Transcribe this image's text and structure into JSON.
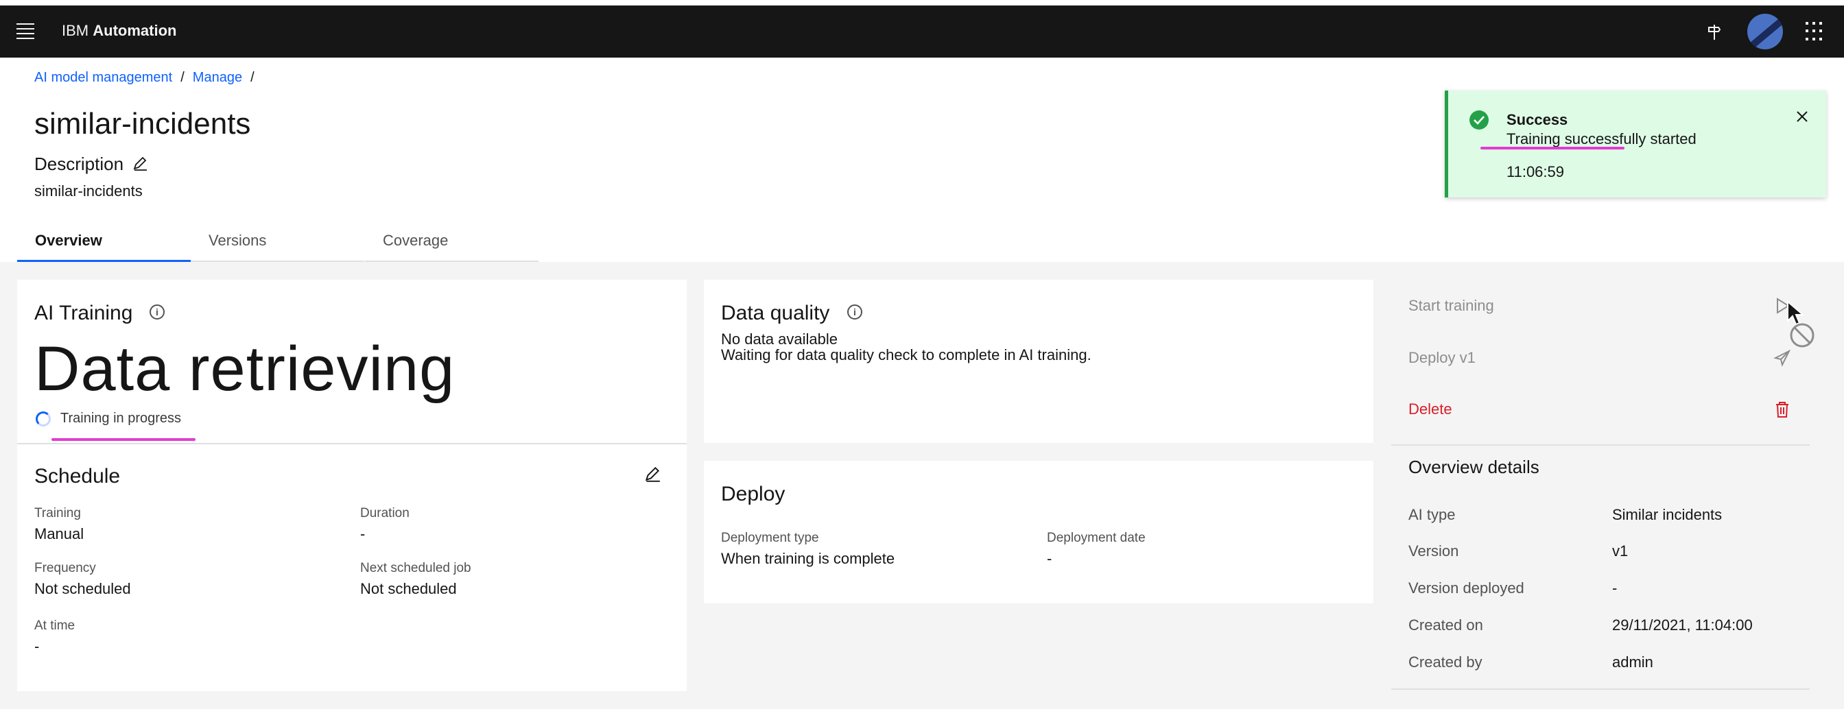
{
  "header": {
    "brand_prefix": "IBM",
    "brand_name": "Automation"
  },
  "breadcrumb": {
    "items": [
      "AI model management",
      "Manage"
    ],
    "separator": "/"
  },
  "page": {
    "title": "similar-incidents",
    "description_label": "Description",
    "description_value": "similar-incidents"
  },
  "tabs": [
    {
      "label": "Overview",
      "active": true
    },
    {
      "label": "Versions",
      "active": false
    },
    {
      "label": "Coverage",
      "active": false
    }
  ],
  "ai_training": {
    "title": "AI Training",
    "status": "Data retrieving",
    "progress_label": "Training in progress"
  },
  "schedule": {
    "title": "Schedule",
    "fields": [
      {
        "label": "Training",
        "value": "Manual"
      },
      {
        "label": "Duration",
        "value": "-"
      },
      {
        "label": "Frequency",
        "value": "Not scheduled"
      },
      {
        "label": "Next scheduled job",
        "value": "Not scheduled"
      },
      {
        "label": "At time",
        "value": "-"
      }
    ]
  },
  "data_quality": {
    "title": "Data quality",
    "line1": "No data available",
    "line2": "Waiting for data quality check to complete in AI training."
  },
  "deploy": {
    "title": "Deploy",
    "fields": [
      {
        "label": "Deployment type",
        "value": "When training is complete"
      },
      {
        "label": "Deployment date",
        "value": "-"
      }
    ]
  },
  "actions": {
    "start_training": "Start training",
    "deploy": "Deploy v1",
    "delete": "Delete"
  },
  "overview_details": {
    "title": "Overview details",
    "rows": [
      {
        "label": "AI type",
        "value": "Similar incidents"
      },
      {
        "label": "Version",
        "value": "v1"
      },
      {
        "label": "Version deployed",
        "value": "-"
      },
      {
        "label": "Created on",
        "value": "29/11/2021, 11:04:00"
      },
      {
        "label": "Created by",
        "value": "admin"
      }
    ]
  },
  "toast": {
    "title": "Success",
    "subtitle": "Training successfully started",
    "time": "11:06:59"
  },
  "colors": {
    "link": "#0f62fe",
    "success": "#24a148",
    "danger": "#da1e28",
    "highlight": "#e33bd1"
  }
}
